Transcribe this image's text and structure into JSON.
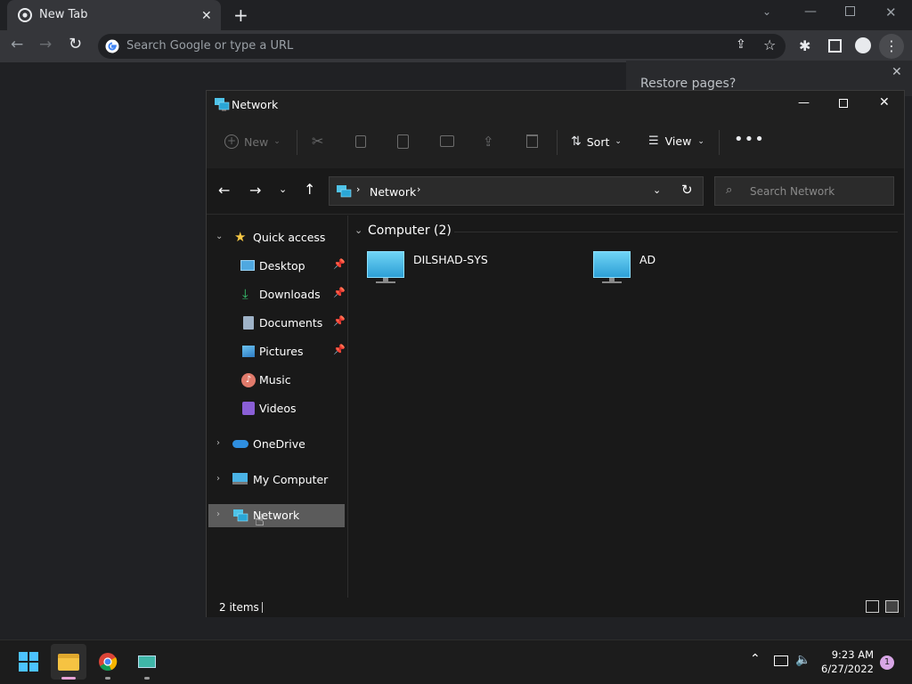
{
  "browser": {
    "tab_title": "New Tab",
    "new_tab_symbol": "+",
    "omnibox_placeholder": "Search Google or type a URL",
    "restore_text": "Restore pages?",
    "accent_color": "#8ab4f8"
  },
  "explorer": {
    "title": "Network",
    "commands": {
      "new_label": "New",
      "sort_label": "Sort",
      "view_label": "View"
    },
    "breadcrumb": [
      "Network"
    ],
    "search_placeholder": "Search Network",
    "nav": {
      "quick_access": "Quick access",
      "pinned": [
        {
          "label": "Desktop",
          "icon": "desktop-folder-icon"
        },
        {
          "label": "Downloads",
          "icon": "downloads-folder-icon"
        },
        {
          "label": "Documents",
          "icon": "documents-folder-icon"
        },
        {
          "label": "Pictures",
          "icon": "pictures-folder-icon"
        }
      ],
      "others": [
        {
          "label": "Music",
          "icon": "music-folder-icon"
        },
        {
          "label": "Videos",
          "icon": "videos-folder-icon"
        }
      ],
      "onedrive": "OneDrive",
      "my_computer": "My Computer",
      "network": "Network"
    },
    "group_header": "Computer (2)",
    "items": [
      {
        "name": "DILSHAD-SYS",
        "icon": "computer-icon"
      },
      {
        "name": "AD",
        "icon": "computer-icon"
      }
    ],
    "status_count": "2 items"
  },
  "taskbar": {
    "time": "9:23 AM",
    "date": "6/27/2022",
    "notification_count": "1",
    "apps": [
      "start-icon",
      "file-explorer-icon",
      "chrome-icon",
      "app-icon"
    ]
  }
}
